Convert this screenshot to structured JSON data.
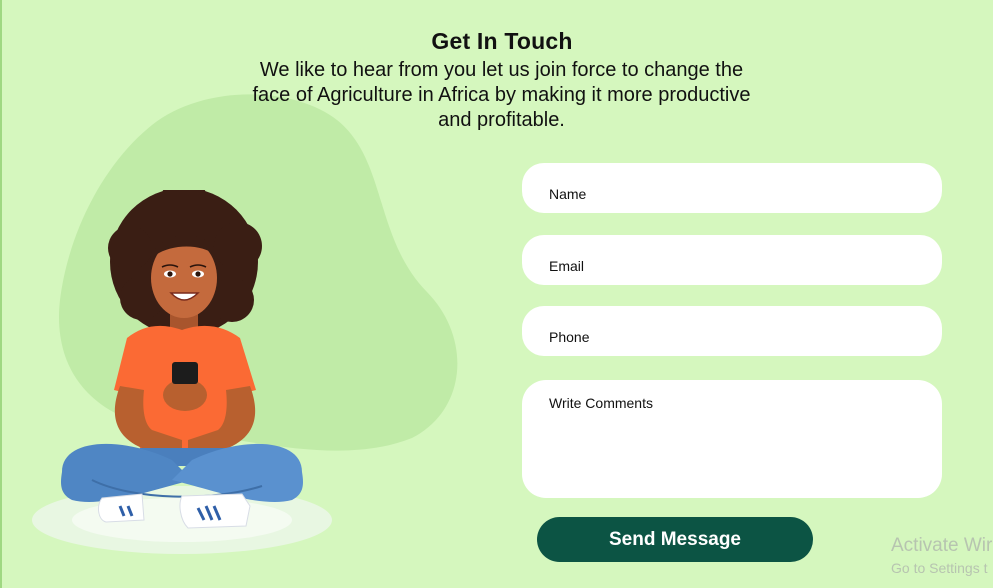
{
  "header": {
    "title": "Get In Touch",
    "subtitle": "We like to hear from you let us join force to change the face of Agriculture in Africa by making it more productive and profitable."
  },
  "form": {
    "name_placeholder": "Name",
    "email_placeholder": "Email",
    "phone_placeholder": "Phone",
    "comments_placeholder": "Write Comments",
    "send_label": "Send Message"
  },
  "watermark": {
    "line1": "Activate Wir",
    "line2": "Go to Settings t"
  },
  "colors": {
    "background": "#d5f7be",
    "blob": "#c0eba7",
    "button": "#0c5444",
    "shirt": "#fb6a34",
    "jeans": "#4f86c4"
  }
}
